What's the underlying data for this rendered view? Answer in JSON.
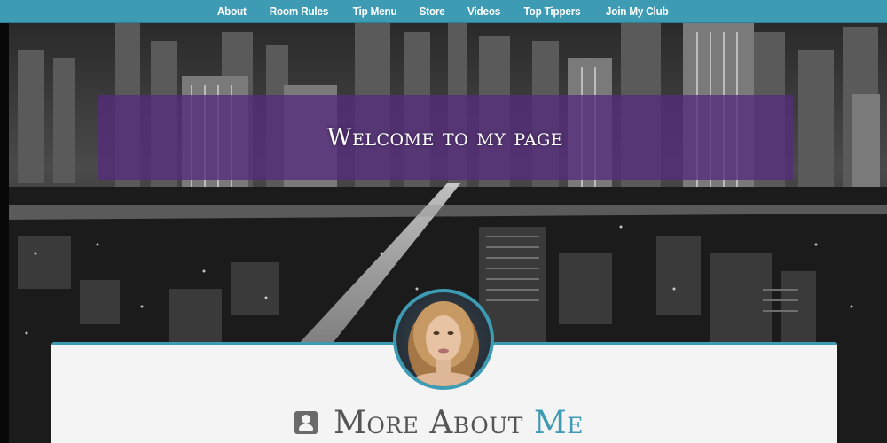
{
  "nav": {
    "items": [
      "About",
      "Room Rules",
      "Tip Menu",
      "Store",
      "Videos",
      "Top Tippers",
      "Join My Club"
    ]
  },
  "hero": {
    "welcome": "Welcome to my page"
  },
  "about": {
    "heading_main": "More About",
    "heading_accent": "Me"
  },
  "colors": {
    "accent": "#3e9bb4",
    "band": "#542c7c",
    "card": "#f4f4f4"
  },
  "icons": {
    "section": "contact-card-icon"
  }
}
